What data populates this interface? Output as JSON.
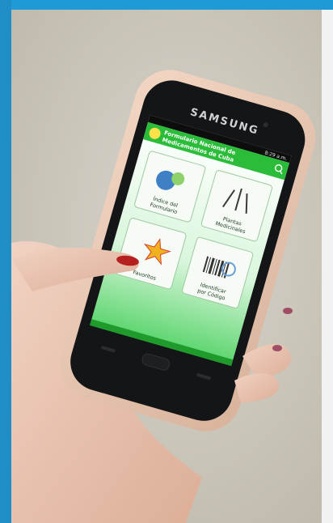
{
  "phone": {
    "brand": "SAMSUNG",
    "status_time": "8:29 a.m."
  },
  "app": {
    "title_line1": "Formulario Nacional de",
    "title_line2": "Medicamentos de Cuba",
    "tiles": [
      {
        "label_line1": "Índice del",
        "label_line2": "Formulario"
      },
      {
        "label_line1": "Plantas",
        "label_line2": "Medicinales"
      },
      {
        "label_line1": "",
        "label_line2": "Favoritos"
      },
      {
        "label_line1": "Identificar",
        "label_line2": "por Código"
      }
    ]
  },
  "colors": {
    "top_bar": "#1e9bd7",
    "wall": "#cdc8bd",
    "left_border": "#1f8ec7",
    "app_green": "#2bbd3a",
    "case": "#e8c9b4"
  }
}
